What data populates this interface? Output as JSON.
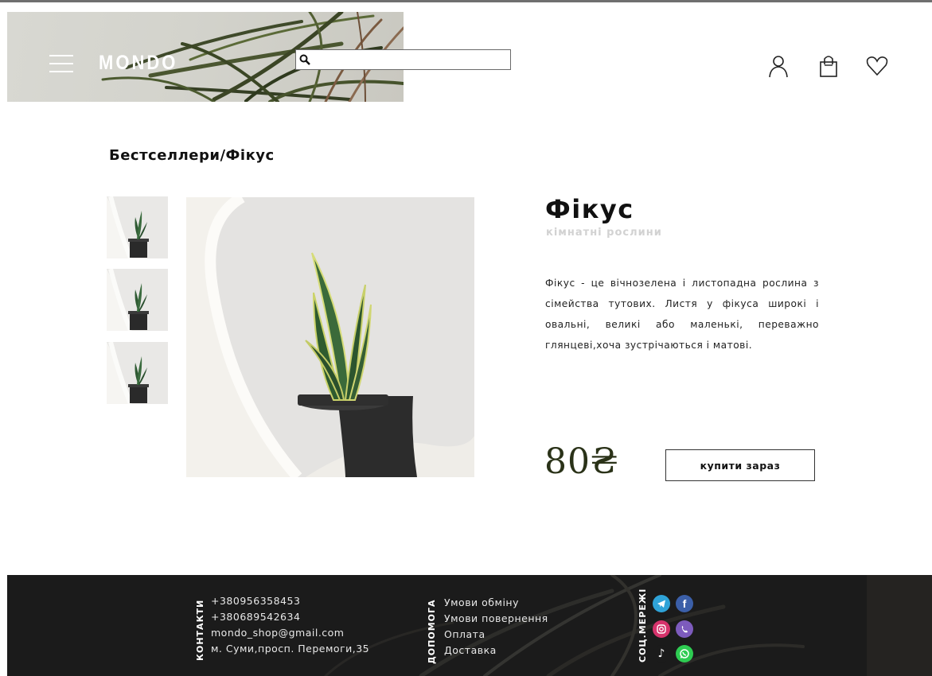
{
  "header": {
    "logo": "MONDO",
    "search": {
      "value": "",
      "placeholder": ""
    },
    "icons": [
      "menu-icon",
      "user-icon",
      "cart-icon",
      "heart-icon"
    ]
  },
  "breadcrumb": "Бестселлери/Фікус",
  "product": {
    "title": "Фікус",
    "category": "кімнатні рослини",
    "description": "Фікус - це вічнозелена і листопадна рослина з сімейства тутових. Листя у фікуса широкі і овальні, великі або маленькі, переважно глянцеві,хоча зустрічаються і матові.",
    "price": "80₴",
    "buy_label": "купити зараз"
  },
  "footer": {
    "contacts_label": "КОНТАКТИ",
    "contacts": [
      "+380956358453",
      "+380689542634",
      "mondo_shop@gmail.com",
      "м. Суми,просп. Перемоги,35"
    ],
    "help_label": "ДОПОМОГА",
    "help": [
      "Умови обміну",
      "Умови повернення",
      "Оплата",
      "Доставка"
    ],
    "social_label": "СОЦ.МЕРЕЖІ",
    "social": [
      "telegram-icon",
      "facebook-icon",
      "instagram-icon",
      "viber-icon",
      "tiktok-icon",
      "whatsapp-icon"
    ]
  },
  "colors": {
    "price": "#2a3218",
    "footer_bg": "#1b1b1b",
    "category": "#d2d2d2"
  }
}
